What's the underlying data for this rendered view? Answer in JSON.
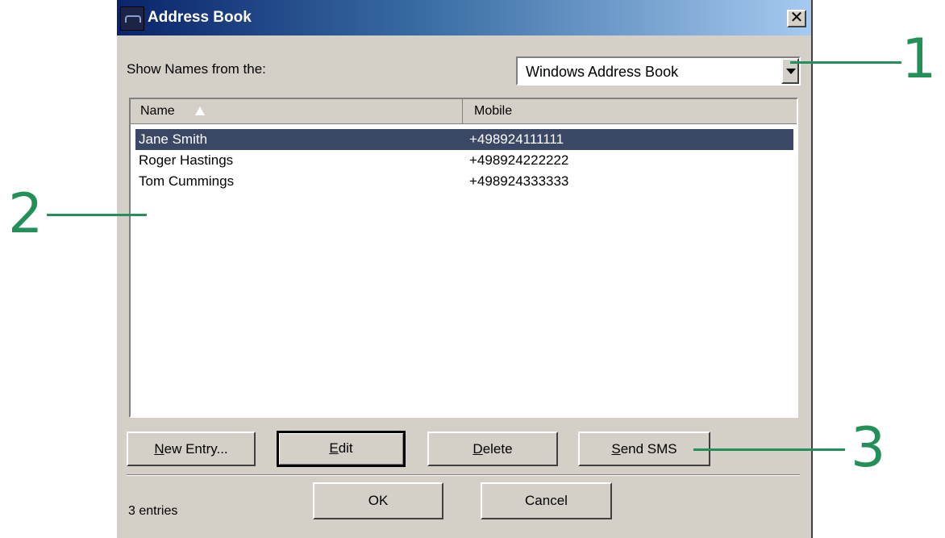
{
  "window": {
    "title": "Address Book",
    "close_glyph": "✕"
  },
  "source": {
    "label": "Show Names from the:",
    "selected": "Windows Address Book"
  },
  "table": {
    "columns": {
      "name": "Name",
      "mobile": "Mobile"
    },
    "sort_icon": "sort-ascending-icon",
    "rows": [
      {
        "name": "Jane Smith",
        "mobile": "+498924111111",
        "selected": true
      },
      {
        "name": "Roger Hastings",
        "mobile": "+498924222222",
        "selected": false
      },
      {
        "name": "Tom Cummings",
        "mobile": "+498924333333",
        "selected": false
      }
    ]
  },
  "actions": {
    "new_entry": {
      "accel": "N",
      "rest": "ew Entry..."
    },
    "edit": {
      "accel": "E",
      "rest": "dit"
    },
    "delete": {
      "accel": "D",
      "rest": "elete"
    },
    "send_sms": {
      "accel": "S",
      "rest": "end SMS"
    }
  },
  "footer": {
    "ok": "OK",
    "cancel": "Cancel",
    "entries": "3 entries"
  },
  "callouts": [
    "1",
    "2",
    "3"
  ],
  "colors": {
    "callout": "#23905a",
    "selection": "#3a4866",
    "title_start": "#0a246a"
  }
}
